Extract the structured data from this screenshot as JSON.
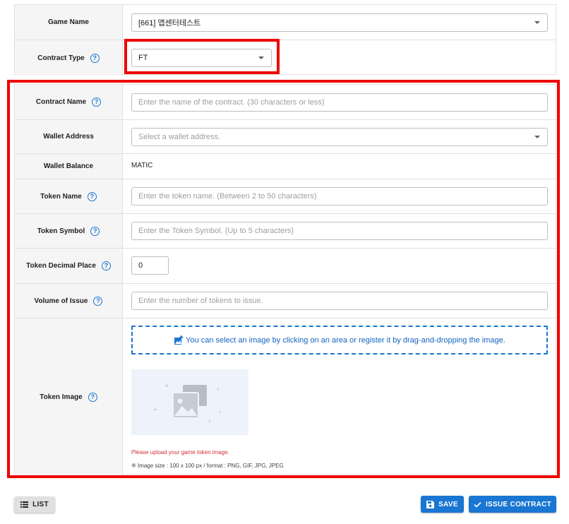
{
  "game_name": {
    "label": "Game Name",
    "value": "[661] 앱센터테스트"
  },
  "contract_type": {
    "label": "Contract Type",
    "value": "FT"
  },
  "contract_name": {
    "label": "Contract Name",
    "placeholder": "Enter the name of the contract. (30 characters or less)"
  },
  "wallet_address": {
    "label": "Wallet Address",
    "placeholder": "Select a wallet address."
  },
  "wallet_balance": {
    "label": "Wallet Balance",
    "value": "MATIC"
  },
  "token_name": {
    "label": "Token Name",
    "placeholder": "Enter the token name. (Between 2 to 50 characters)"
  },
  "token_symbol": {
    "label": "Token Symbol",
    "placeholder": "Enter the Token Symbol. (Up to 5 characters)"
  },
  "token_decimal": {
    "label": "Token Decimal Place",
    "value": "0"
  },
  "volume_of_issue": {
    "label": "Volume of Issue",
    "placeholder": "Enter the number of tokens to issue."
  },
  "token_image": {
    "label": "Token Image",
    "dropzone_text": "You can select an image by clicking on an area or register it by drag-and-dropping the image.",
    "error_text": "Please upload your game token image.",
    "note_text": "※ Image size : 100 x 100 px / format : PNG, GIF, JPG, JPEG"
  },
  "help_icon_glyph": "?",
  "buttons": {
    "list": "LIST",
    "save": "SAVE",
    "issue": "ISSUE CONTRACT"
  },
  "colors": {
    "primary": "#1976d2",
    "highlight": "#ee0000",
    "error": "#d32f2f",
    "label_bg": "#f5f5f5"
  }
}
